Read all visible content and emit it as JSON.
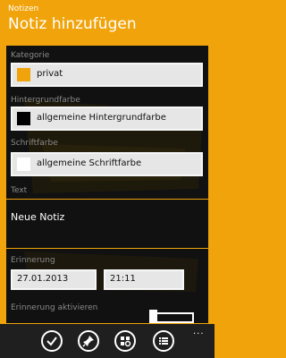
{
  "header": {
    "app_title": "Notizen",
    "page_title": "Notiz hinzufügen"
  },
  "form": {
    "kategorie": {
      "label": "Kategorie",
      "value": "privat",
      "swatch_color": "#F0A30A"
    },
    "hintergrundfarbe": {
      "label": "Hintergrundfarbe",
      "value": "allgemeine Hintergrundfarbe",
      "swatch_color": "#000000"
    },
    "schriftfarbe": {
      "label": "Schriftfarbe",
      "value": "allgemeine Schriftfarbe",
      "swatch_color": "#ffffff"
    },
    "text": {
      "label": "Text",
      "value": "Neue Notiz"
    },
    "erinnerung": {
      "label": "Erinnerung",
      "date": "27.01.2013",
      "time": "21:11"
    },
    "erinnerung_aktivieren": {
      "label": "Erinnerung aktivieren"
    }
  },
  "appbar": {
    "buttons": [
      "check-icon",
      "pin-icon",
      "tile-icon",
      "list-icon"
    ],
    "more": "..."
  },
  "colors": {
    "accent": "#F0A30A",
    "panel": "#111111",
    "appbar": "#1f1f1f"
  }
}
